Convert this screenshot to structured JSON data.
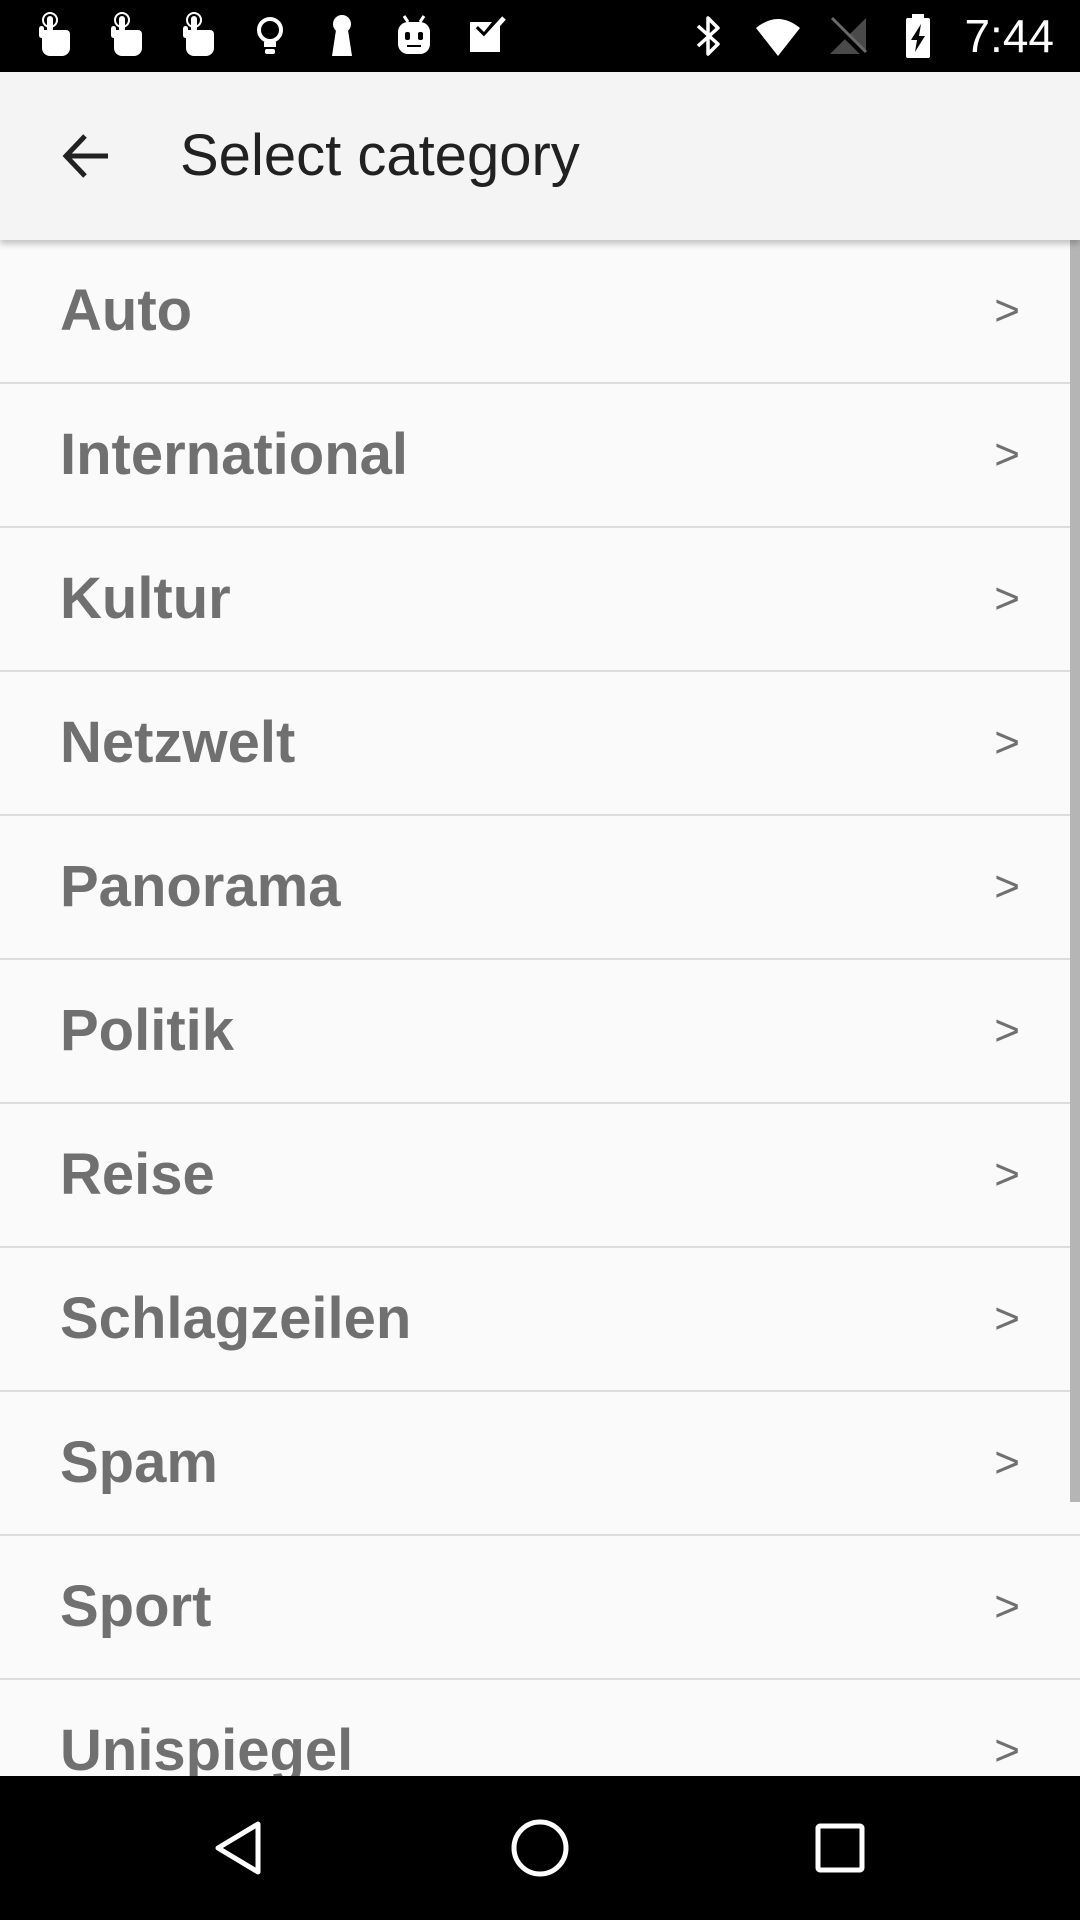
{
  "status_bar": {
    "notification_icons": [
      "touch-icon",
      "touch-icon",
      "touch-icon",
      "lightbulb-icon",
      "keyhole-icon",
      "android-icon",
      "task-check-icon"
    ],
    "system_icons": [
      "bluetooth-icon",
      "wifi-icon",
      "no-signal-icon",
      "battery-charging-icon"
    ],
    "time": "7:44"
  },
  "app_bar": {
    "back_icon": "arrow-back-icon",
    "title": "Select category"
  },
  "categories": [
    {
      "label": "Auto",
      "chevron": ">"
    },
    {
      "label": "International",
      "chevron": ">"
    },
    {
      "label": "Kultur",
      "chevron": ">"
    },
    {
      "label": "Netzwelt",
      "chevron": ">"
    },
    {
      "label": "Panorama",
      "chevron": ">"
    },
    {
      "label": "Politik",
      "chevron": ">"
    },
    {
      "label": "Reise",
      "chevron": ">"
    },
    {
      "label": "Schlagzeilen",
      "chevron": ">"
    },
    {
      "label": "Spam",
      "chevron": ">"
    },
    {
      "label": "Sport",
      "chevron": ">"
    },
    {
      "label": "Unispiegel",
      "chevron": ">"
    }
  ],
  "nav_bar": {
    "buttons": [
      "back-triangle-icon",
      "home-circle-icon",
      "recents-square-icon"
    ]
  },
  "colors": {
    "status_bar": "#000000",
    "app_bar": "#f4f4f4",
    "list_background": "#fafafa",
    "row_text": "#707070",
    "divider": "#dcdcdc",
    "title_text": "#212121"
  }
}
